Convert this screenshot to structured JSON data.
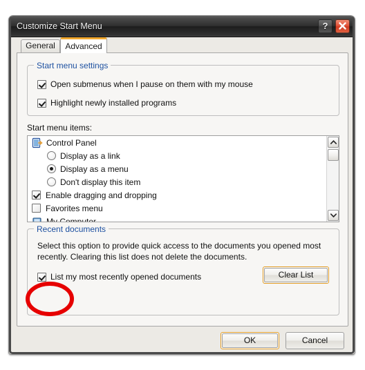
{
  "window": {
    "title": "Customize Start Menu",
    "help_label": "?",
    "close_label": "×"
  },
  "tabs": [
    {
      "label": "General",
      "selected": false
    },
    {
      "label": "Advanced",
      "selected": true
    }
  ],
  "start_menu_settings": {
    "legend": "Start menu settings",
    "options": [
      {
        "label": "Open submenus when I pause on them with my mouse",
        "checked": true
      },
      {
        "label": "Highlight newly installed programs",
        "checked": true
      }
    ]
  },
  "start_menu_items": {
    "label": "Start menu items:",
    "entries": [
      {
        "label": "Control Panel",
        "type": "icon",
        "icon": "control-panel-icon"
      },
      {
        "label": "Display as a link",
        "type": "radio",
        "checked": false
      },
      {
        "label": "Display as a menu",
        "type": "radio",
        "checked": true
      },
      {
        "label": "Don't display this item",
        "type": "radio",
        "checked": false
      },
      {
        "label": "Enable dragging and dropping",
        "type": "checkbox",
        "checked": true
      },
      {
        "label": "Favorites menu",
        "type": "checkbox",
        "checked": false
      },
      {
        "label": "My Computer",
        "type": "icon",
        "icon": "my-computer-icon"
      }
    ],
    "scrollbar": {
      "up_icon": "chevron-up-icon",
      "down_icon": "chevron-down-icon"
    }
  },
  "recent_documents": {
    "legend": "Recent documents",
    "description": "Select this option to provide quick access to the documents you opened most recently.  Clearing this list does not delete the documents.",
    "checkbox_label": "List my most recently opened documents",
    "checkbox_checked": true,
    "clear_button": "Clear List"
  },
  "footer": {
    "ok": "OK",
    "cancel": "Cancel"
  },
  "annotation": {
    "shape": "ellipse",
    "color": "#e60000",
    "target": "list-my-most-recently-opened-documents-checkbox"
  },
  "colors": {
    "accent_orange": "#f0a830",
    "legend_blue": "#1d50a0",
    "titlebar_dark": "#2f2f2f",
    "close_red": "#cf3b22",
    "annotation_red": "#e60000"
  }
}
